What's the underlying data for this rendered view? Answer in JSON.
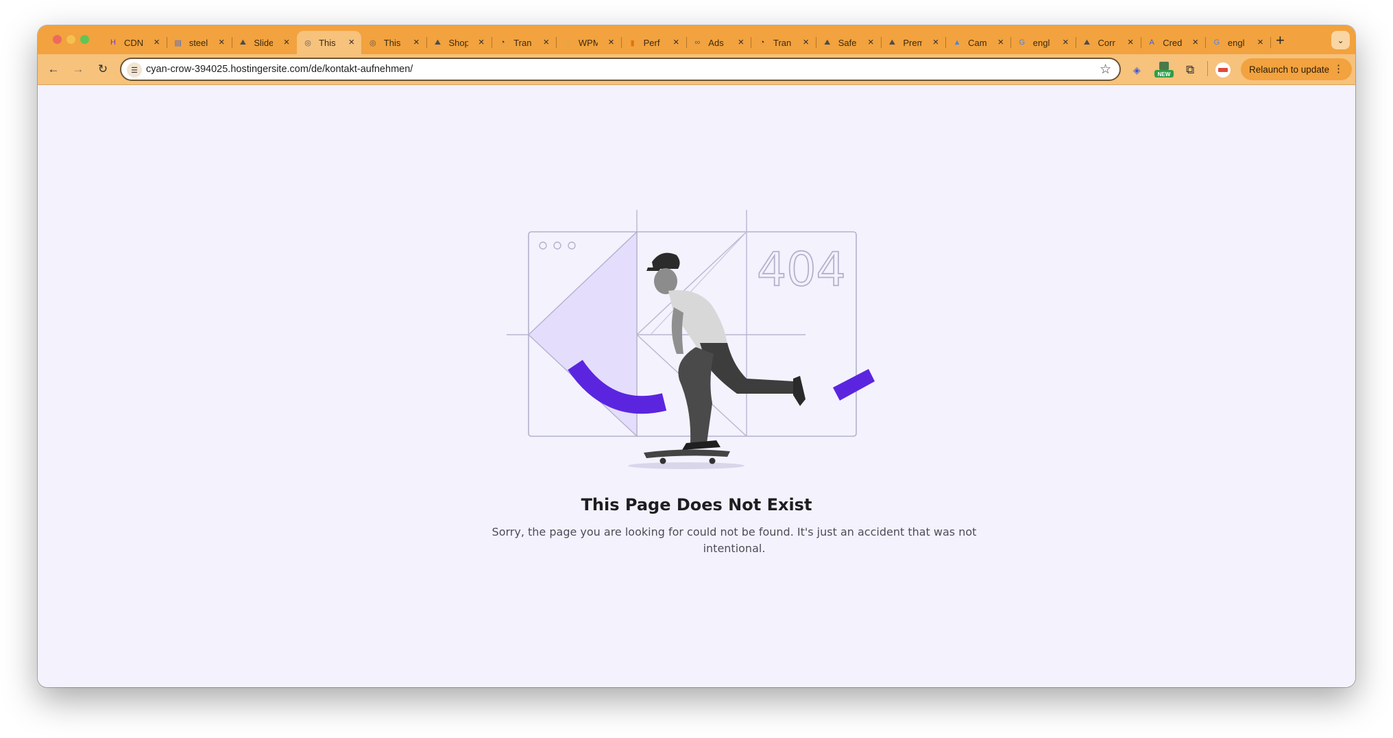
{
  "browser": {
    "tabs": [
      {
        "title": "CDN",
        "icon": "hostinger-icon",
        "active": false
      },
      {
        "title": "steel",
        "icon": "doc-icon",
        "active": false
      },
      {
        "title": "Slides",
        "icon": "mountain-icon",
        "active": false
      },
      {
        "title": "This",
        "icon": "globe-icon",
        "active": true
      },
      {
        "title": "This",
        "icon": "globe-icon",
        "active": false
      },
      {
        "title": "Shop",
        "icon": "mountain-icon",
        "active": false
      },
      {
        "title": "Tran",
        "icon": "loop-icon",
        "active": false
      },
      {
        "title": "WPM",
        "icon": "gear-icon",
        "active": false
      },
      {
        "title": "Perf",
        "icon": "analytics-icon",
        "active": false
      },
      {
        "title": "Ads",
        "icon": "meta-icon",
        "active": false
      },
      {
        "title": "Tran",
        "icon": "loop-icon",
        "active": false
      },
      {
        "title": "Safe",
        "icon": "mountain-icon",
        "active": false
      },
      {
        "title": "Prem",
        "icon": "mountain-icon",
        "active": false
      },
      {
        "title": "Cam",
        "icon": "google-ads-icon",
        "active": false
      },
      {
        "title": "engl",
        "icon": "google-icon",
        "active": false
      },
      {
        "title": "Corr",
        "icon": "mountain-icon",
        "active": false
      },
      {
        "title": "Cred",
        "icon": "api-icon",
        "active": false
      },
      {
        "title": "engl",
        "icon": "google-icon",
        "active": false
      }
    ],
    "address": "cyan-crow-394025.hostingersite.com/de/kontakt-aufnehmen/",
    "relaunch_label": "Relaunch to update",
    "extension_badge": "NEW",
    "colors": {
      "tabstrip": "#f2a23e",
      "toolbar": "#f6c27c"
    }
  },
  "page": {
    "illustration_code": "404",
    "headline": "This Page Does Not Exist",
    "description": "Sorry, the page you are looking for could not be found. It's just an accident that was not intentional.",
    "colors": {
      "accent": "#5b25e0",
      "panel": "#e4ddfb",
      "background": "#f3f2fd"
    }
  }
}
